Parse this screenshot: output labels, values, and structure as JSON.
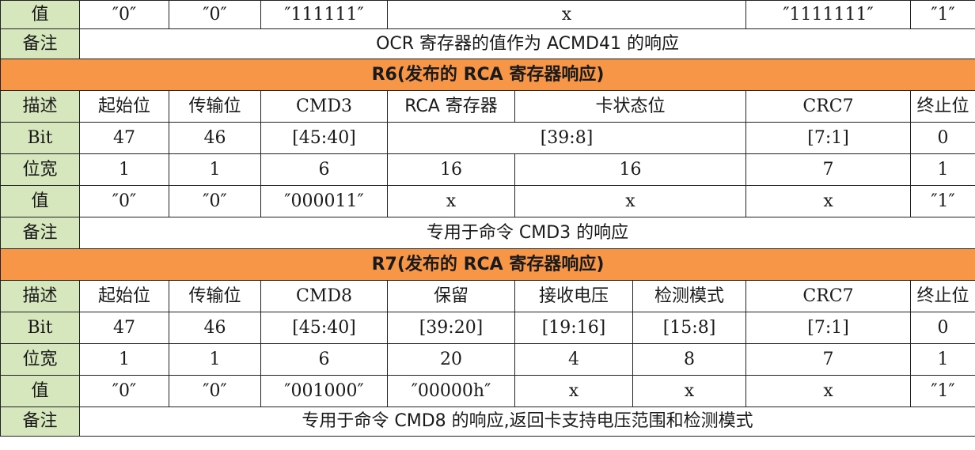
{
  "top": {
    "val_label": "值",
    "v1": "″0″",
    "v2": "″0″",
    "v3": "″111111″",
    "v4": "x",
    "v5": "″1111111″",
    "v6": "″1″",
    "note_label": "备注",
    "note": "OCR 寄存器的值作为 ACMD41 的响应"
  },
  "r6": {
    "title": "R6(发布的 RCA 寄存器响应)",
    "desc": [
      "描述",
      "起始位",
      "传输位",
      "CMD3",
      "RCA 寄存器",
      "卡状态位",
      "CRC7",
      "终止位"
    ],
    "bit": [
      "Bit",
      "47",
      "46",
      "[45:40]",
      "[39:8]",
      "[7:1]",
      "0"
    ],
    "width": [
      "位宽",
      "1",
      "1",
      "6",
      "16",
      "16",
      "7",
      "1"
    ],
    "value": [
      "值",
      "″0″",
      "″0″",
      "″000011″",
      "x",
      "x",
      "x",
      "″1″"
    ],
    "note_label": "备注",
    "note": "专用于命令 CMD3 的响应"
  },
  "r7": {
    "title": "R7(发布的 RCA 寄存器响应)",
    "desc": [
      "描述",
      "起始位",
      "传输位",
      "CMD8",
      "保留",
      "接收电压",
      "检测模式",
      "CRC7",
      "终止位"
    ],
    "bit": [
      "Bit",
      "47",
      "46",
      "[45:40]",
      "[39:20]",
      "[19:16]",
      "[15:8]",
      "[7:1]",
      "0"
    ],
    "width": [
      "位宽",
      "1",
      "1",
      "6",
      "20",
      "4",
      "8",
      "7",
      "1"
    ],
    "value": [
      "值",
      "″0″",
      "″0″",
      "″001000″",
      "″00000h″",
      "x",
      "x",
      "x",
      "″1″"
    ],
    "note_label": "备注",
    "note": "专用于命令 CMD8 的响应,返回卡支持电压范围和检测模式"
  },
  "colors": {
    "label_bg": "#d7e7bd",
    "title_bg": "#f79646",
    "border": "#222222"
  }
}
